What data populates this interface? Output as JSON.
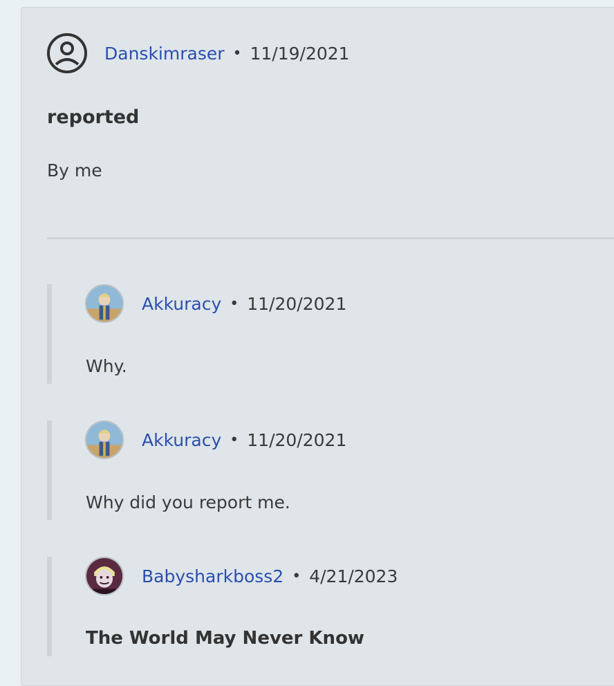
{
  "post": {
    "username": "Danskimraser",
    "date": "11/19/2021",
    "title": "reported",
    "body": "By me"
  },
  "replies": [
    {
      "username": "Akkuracy",
      "date": "11/20/2021",
      "body": "Why.",
      "body_bold": false
    },
    {
      "username": "Akkuracy",
      "date": "11/20/2021",
      "body": "Why did you report me.",
      "body_bold": false
    },
    {
      "username": "Babysharkboss2",
      "date": "4/21/2023",
      "body": "The World May Never Know",
      "body_bold": true
    }
  ],
  "separator": "•",
  "colors": {
    "link": "#2a4fb0",
    "card": "#dfe5e8",
    "page": "#eaf1f3"
  }
}
